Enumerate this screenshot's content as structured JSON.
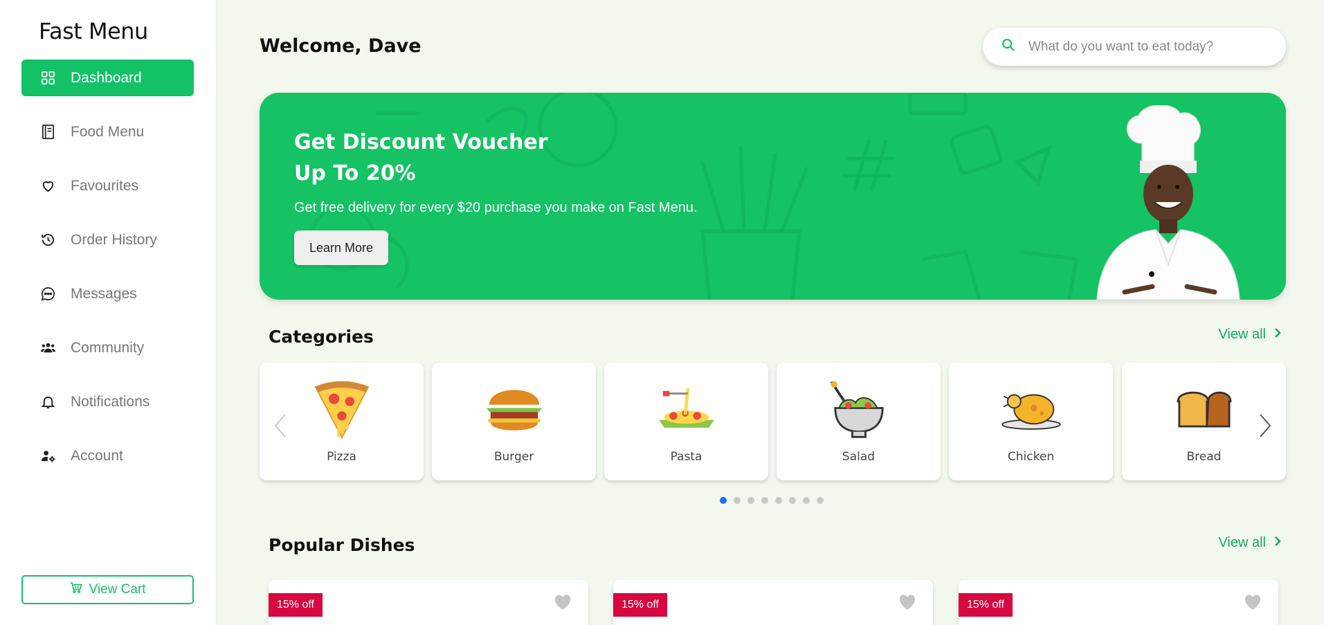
{
  "app": {
    "name": "Fast Menu"
  },
  "sidebar": {
    "items": [
      {
        "label": "Dashboard",
        "icon": "dashboard-icon",
        "active": true
      },
      {
        "label": "Food Menu",
        "icon": "menu-book-icon"
      },
      {
        "label": "Favourites",
        "icon": "heart-icon"
      },
      {
        "label": "Order History",
        "icon": "history-icon"
      },
      {
        "label": "Messages",
        "icon": "chat-icon"
      },
      {
        "label": "Community",
        "icon": "people-icon"
      },
      {
        "label": "Notifications",
        "icon": "bell-icon"
      },
      {
        "label": "Account",
        "icon": "user-settings-icon"
      }
    ],
    "cart_label": "View Cart"
  },
  "header": {
    "welcome": "Welcome, Dave",
    "search_placeholder": "What do you want to eat today?"
  },
  "banner": {
    "title_line1": "Get Discount Voucher",
    "title_line2": "Up To 20%",
    "subtitle": "Get free delivery for every $20 purchase you make on Fast Menu.",
    "button": "Learn More"
  },
  "categories": {
    "title": "Categories",
    "view_all": "View all",
    "items": [
      {
        "label": "Pizza",
        "icon": "pizza-icon"
      },
      {
        "label": "Burger",
        "icon": "burger-icon"
      },
      {
        "label": "Pasta",
        "icon": "pasta-icon"
      },
      {
        "label": "Salad",
        "icon": "salad-icon"
      },
      {
        "label": "Chicken",
        "icon": "chicken-icon"
      },
      {
        "label": "Bread",
        "icon": "bread-icon"
      }
    ],
    "pagination": {
      "count": 8,
      "active": 1
    }
  },
  "popular": {
    "title": "Popular Dishes",
    "view_all": "View all",
    "items": [
      {
        "badge": "15% off"
      },
      {
        "badge": "15% off"
      },
      {
        "badge": "15% off"
      }
    ]
  },
  "colors": {
    "accent": "#13c167",
    "badge": "#d6083f",
    "background": "#f3f8ee",
    "dot_active": "#1a73e8"
  }
}
